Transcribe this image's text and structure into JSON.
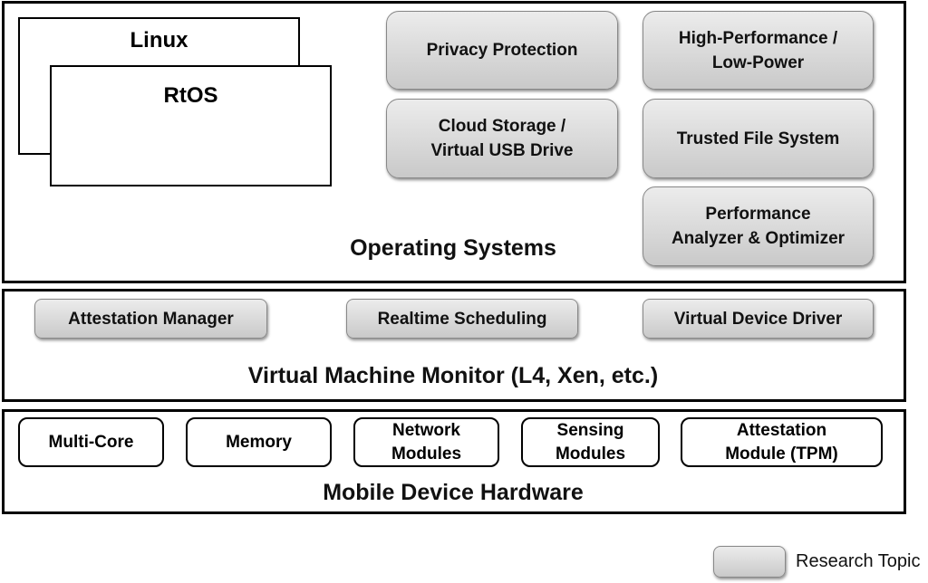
{
  "os_layer": {
    "title": "Operating Systems",
    "os": [
      "Linux",
      "RtOS"
    ],
    "topics": [
      "Privacy Protection",
      "Cloud Storage /\nVirtual USB Drive",
      "High-Performance /\nLow-Power",
      "Trusted File System",
      "Performance\nAnalyzer & Optimizer"
    ]
  },
  "vmm_layer": {
    "title": "Virtual Machine Monitor (L4, Xen, etc.)",
    "topics": [
      "Attestation Manager",
      "Realtime Scheduling",
      "Virtual Device Driver"
    ]
  },
  "hw_layer": {
    "title": "Mobile Device Hardware",
    "modules": [
      "Multi-Core",
      "Memory",
      "Network\nModules",
      "Sensing\nModules",
      "Attestation\nModule (TPM)"
    ]
  },
  "legend": {
    "label": "Research Topic"
  }
}
